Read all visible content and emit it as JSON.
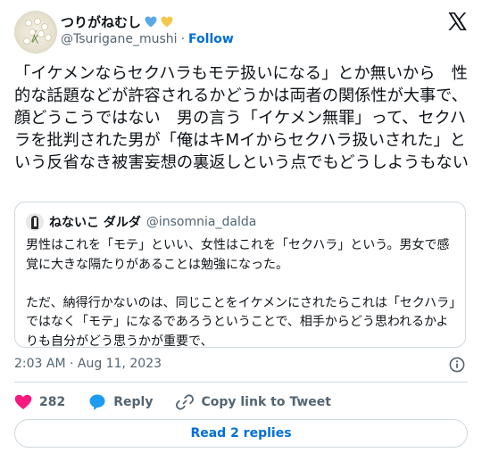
{
  "author": {
    "display_name": "つりがねむし",
    "handle": "@Tsurigane_mushi",
    "follow_label": "Follow",
    "separator": "·",
    "heart_colors": [
      "#5aa9e6",
      "#f2c94c"
    ]
  },
  "tweet": {
    "text": "「イケメンならセクハラもモテ扱いになる」とか無いから　性的な話題などが許容されるかどうかは両者の関係性が大事で、顔どうこうではない　男の言う「イケメン無罪」って、セクハラを批判された男が「俺はキMイからセクハラ扱いされた」という反省なき被害妄想の裏返しという点でもどうしようもない"
  },
  "quote": {
    "display_name": "ねないこ ダルダ",
    "handle": "@insomnia_dalda",
    "text": "男性はこれを「モテ」といい、女性はこれを「セクハラ」という。男女で感覚に大きな隔たりがあることは勉強になった。\n\nただ、納得行かないのは、同じことをイケメンにされたらこれは「セクハラ」ではなく「モテ」になるであろうということで、相手からどう思われるかよりも自分がどう思うかが重要で、"
  },
  "meta": {
    "timestamp": "2:03 AM · Aug 11, 2023"
  },
  "actions": {
    "like_count": "282",
    "reply_label": "Reply",
    "copy_label": "Copy link to Tweet",
    "like_color": "#f91880",
    "reply_color": "#1d9bf0"
  },
  "replies_button": {
    "label": "Read 2 replies"
  },
  "icons": [
    "x-logo-icon",
    "blue-heart-icon",
    "yellow-heart-icon",
    "info-icon",
    "heart-icon",
    "reply-bubble-icon",
    "link-icon"
  ]
}
